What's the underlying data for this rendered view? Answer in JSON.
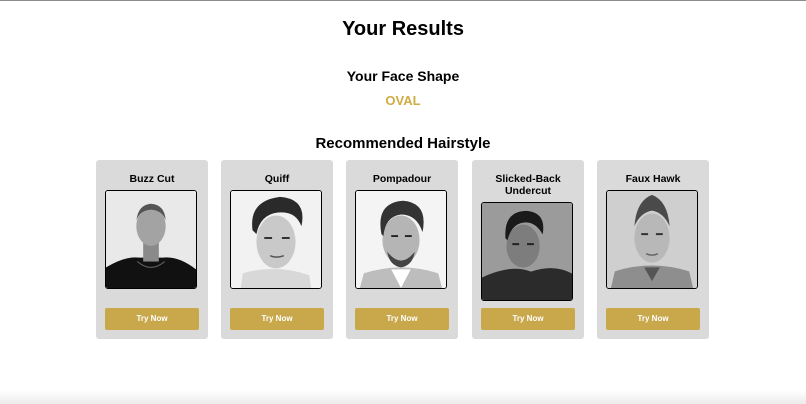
{
  "header": {
    "title": "Your Results"
  },
  "face_shape": {
    "heading": "Your Face Shape",
    "value": "OVAL"
  },
  "recommendations": {
    "heading": "Recommended Hairstyle",
    "cards": [
      {
        "name": "Buzz Cut",
        "button": "Try Now"
      },
      {
        "name": "Quiff",
        "button": "Try Now"
      },
      {
        "name": "Pompadour",
        "button": "Try Now"
      },
      {
        "name": "Slicked-Back Undercut",
        "button": "Try Now"
      },
      {
        "name": "Faux Hawk",
        "button": "Try Now"
      }
    ]
  },
  "colors": {
    "accent": "#c9a84c",
    "face_shape_text": "#d0ac45",
    "card_background": "#dadada"
  }
}
